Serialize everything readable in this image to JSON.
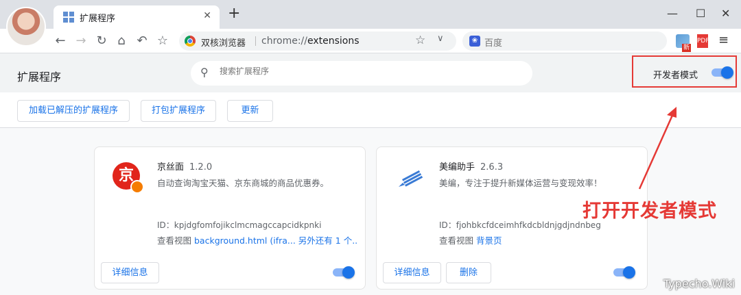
{
  "browser": {
    "tab_title": "扩展程序",
    "tab_close": "✕",
    "new_tab": "+",
    "window_controls": [
      "—",
      "☐",
      "✕"
    ],
    "nav_icons": [
      "arrow-left-icon",
      "arrow-right-icon",
      "reload-icon",
      "home-icon",
      "undo-icon",
      "bookmark-star-icon"
    ],
    "omnibox_site": "双核浏览器",
    "omnibox_scheme": "chrome://",
    "omnibox_path": "extensions",
    "search_placeholder": "百度",
    "ext_badge": "新"
  },
  "header": {
    "title": "扩展程序",
    "search_placeholder": "搜索扩展程序",
    "dev_mode_label": "开发者模式",
    "dev_mode_on": true
  },
  "actions": {
    "load_unpacked": "加载已解压的扩展程序",
    "pack": "打包扩展程序",
    "update": "更新"
  },
  "extensions": [
    {
      "name": "京丝面",
      "version": "1.2.0",
      "description": "自动查询淘宝天猫、京东商城的商品优惠券。",
      "id": "ID：kpjdgfomfojikclmcmagccapcidkpnki",
      "view_label": "查看视图",
      "view_links": "background.html (ifra...  另外还有 1 个...",
      "details_label": "详细信息",
      "enabled": true,
      "logo_char": "京"
    },
    {
      "name": "美编助手",
      "version": "2.6.3",
      "description": "美编，专注于提升新媒体运营与变现效率！",
      "id": "ID：fjohbkcfdceimhfkdcbldnjgdjndnbeg",
      "view_label": "查看视图",
      "view_links": "背景页",
      "details_label": "详细信息",
      "remove_label": "删除",
      "enabled": true
    }
  ],
  "annotation": {
    "text": "打开开发者模式",
    "color": "#e53935"
  },
  "watermark": "Typecho.Wiki"
}
